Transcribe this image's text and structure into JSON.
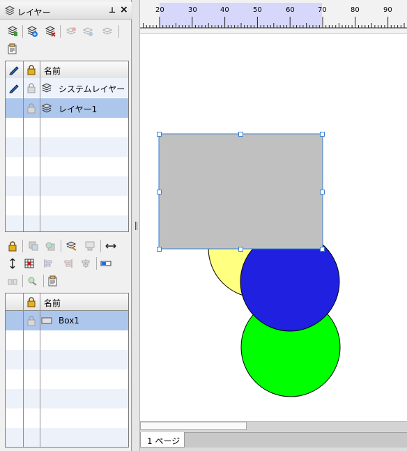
{
  "panel": {
    "title": "レイヤー",
    "pin_label": "⊥",
    "close_label": "×"
  },
  "layer_grid": {
    "header_name": "名前",
    "rows": [
      {
        "name": "システムレイヤー",
        "selected": false,
        "editing": true
      },
      {
        "name": "レイヤー1",
        "selected": true,
        "editing": false
      }
    ]
  },
  "object_grid": {
    "header_name": "名前",
    "rows": [
      {
        "name": "Box1",
        "selected": true
      }
    ]
  },
  "ruler": {
    "ticks": [
      "20",
      "30",
      "40",
      "50",
      "60",
      "70",
      "80",
      "90"
    ]
  },
  "status": {
    "page_tab": "1 ページ"
  },
  "colors": {
    "selection_row": "#adc6ec",
    "alt_row": "#edf2fa",
    "rect_fill": "#c0c0c0",
    "circle_yellow": "#ffff80",
    "circle_blue": "#2020e0",
    "circle_green": "#00ff00",
    "ruler_band": "#d7d7fb"
  }
}
